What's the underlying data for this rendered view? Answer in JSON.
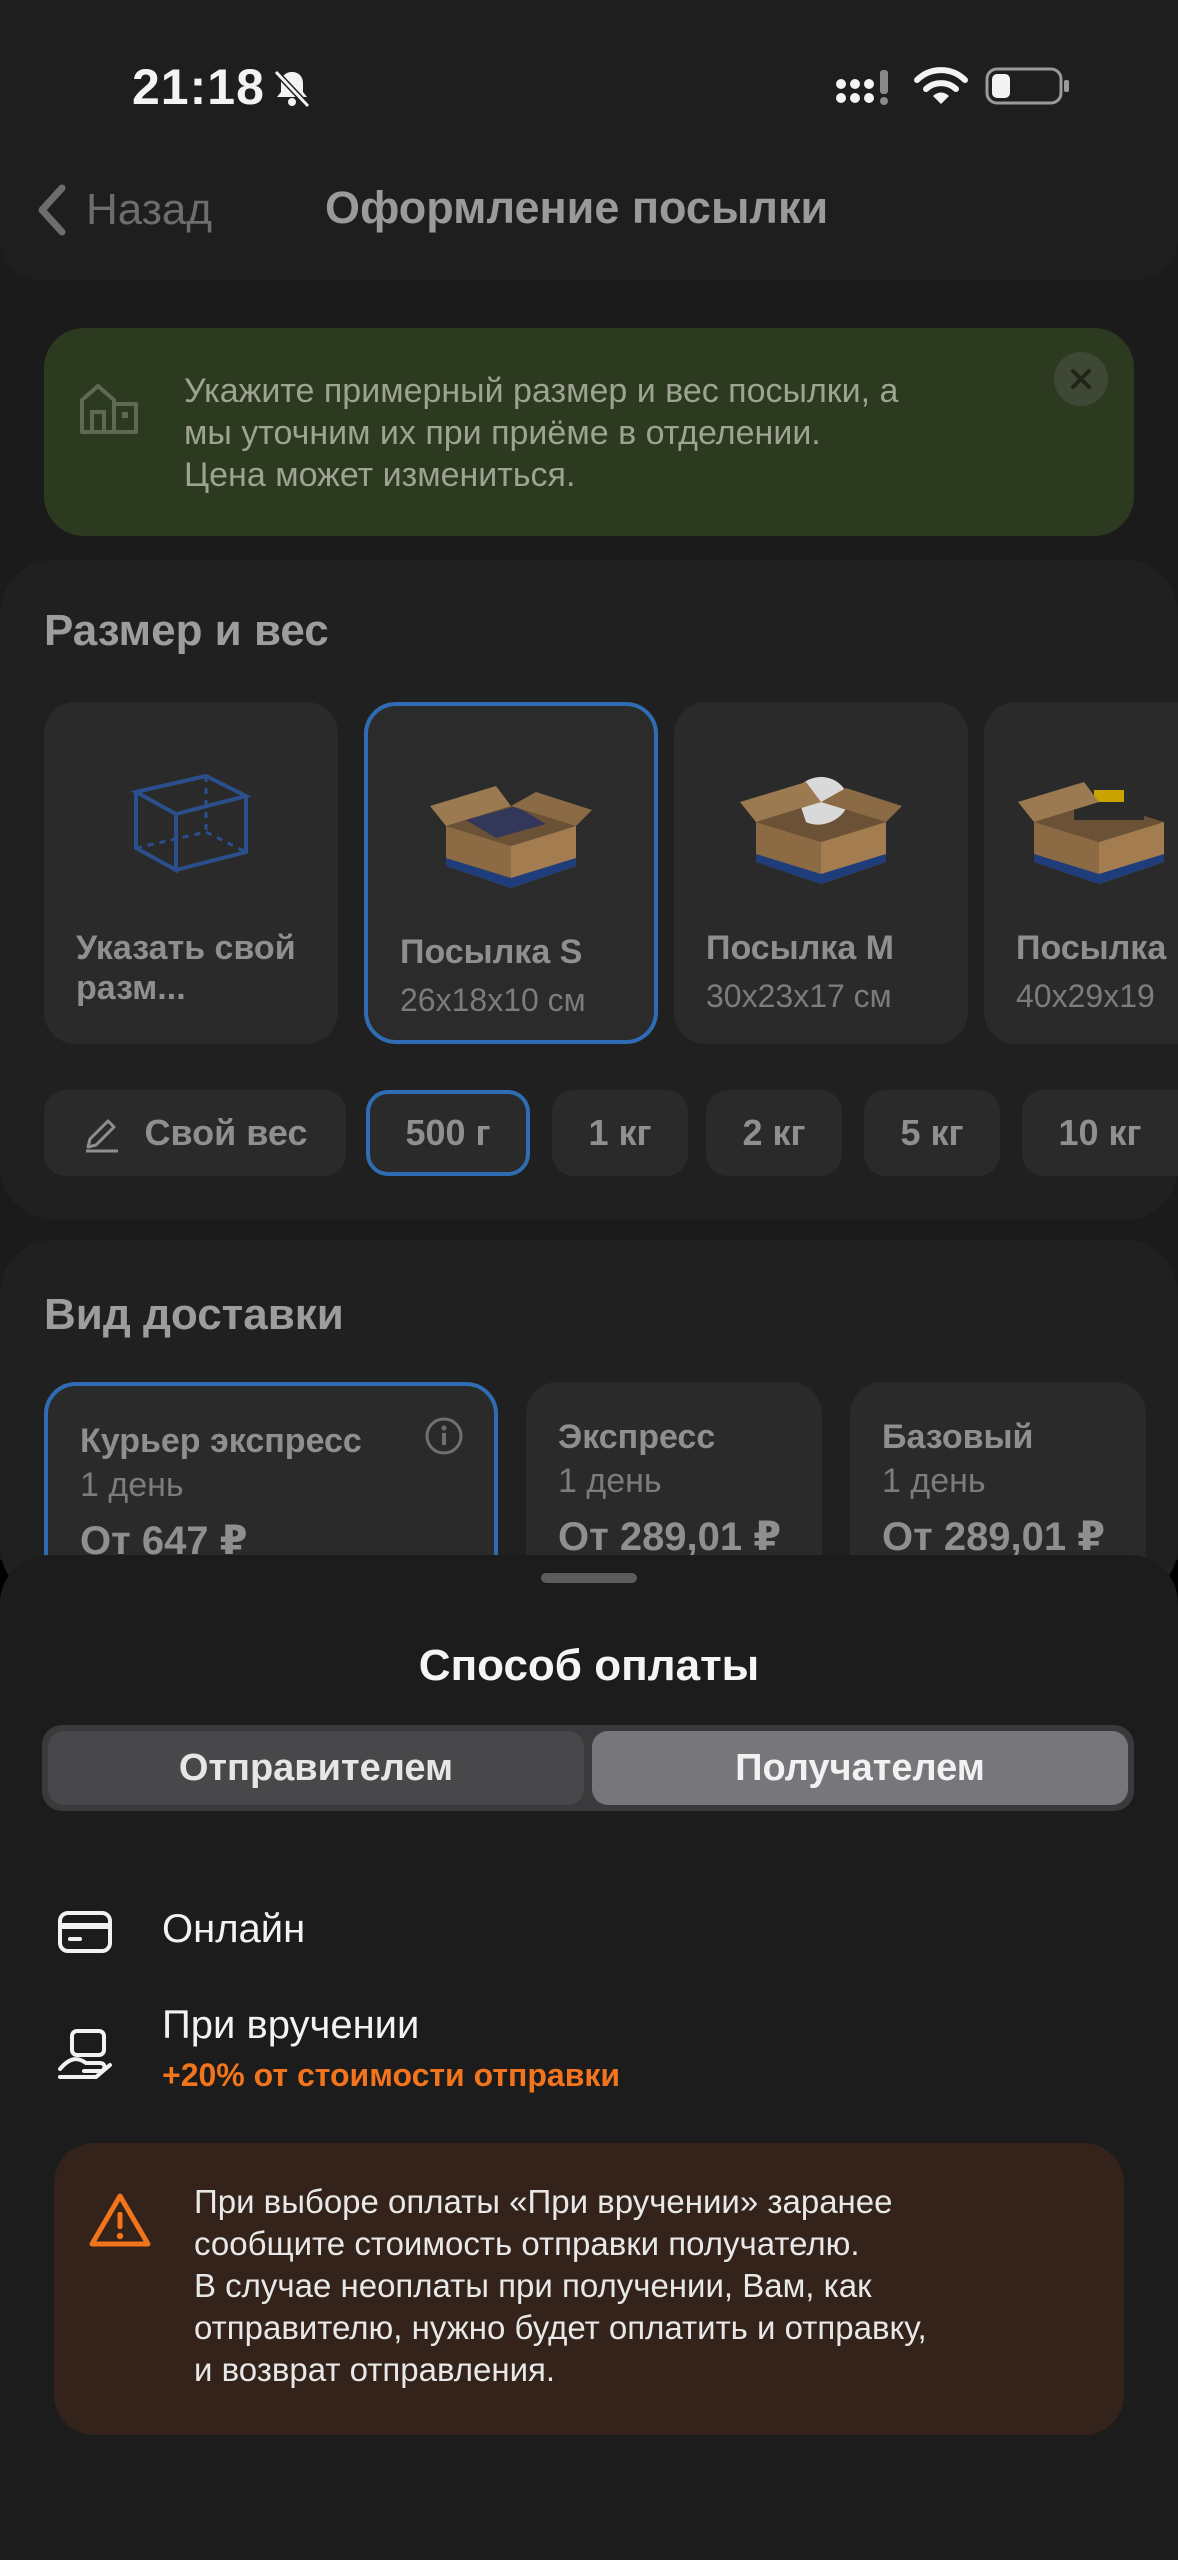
{
  "status_bar": {
    "time": "21:18"
  },
  "nav": {
    "back_label": "Назад",
    "title": "Оформление посылки"
  },
  "notice": {
    "lines": [
      "Укажите примерный размер и вес посылки, а",
      "мы уточним их при приёме в отделении.",
      "Цена может измениться."
    ]
  },
  "size_section": {
    "title": "Размер и вес",
    "tiles": [
      {
        "name": "Указать свой разм...",
        "dims": ""
      },
      {
        "name": "Посылка S",
        "dims": "26x18x10 см"
      },
      {
        "name": "Посылка M",
        "dims": "30x23x17 см"
      },
      {
        "name": "Посылка",
        "dims": "40x29x19"
      }
    ],
    "selected_tile": 1,
    "weights": [
      "Свой вес",
      "500 г",
      "1 кг",
      "2 кг",
      "5 кг",
      "10 кг"
    ],
    "selected_weight": 1
  },
  "delivery_section": {
    "title": "Вид доставки",
    "options": [
      {
        "name": "Курьер экспресс",
        "days": "1 день",
        "price": "От 647 ₽"
      },
      {
        "name": "Экспресс",
        "days": "1 день",
        "price": "От 289,01 ₽"
      },
      {
        "name": "Базовый",
        "days": "1 день",
        "price": "От 289,01 ₽"
      }
    ]
  },
  "payment_sheet": {
    "title": "Способ оплаты",
    "segments": [
      "Отправителем",
      "Получателем"
    ],
    "selected_segment": 1,
    "options": [
      {
        "label": "Онлайн",
        "icon": "card-icon"
      },
      {
        "label": "При вручении",
        "sub": "+20% от стоимости отправки",
        "icon": "hand-cash-icon"
      }
    ],
    "warning": {
      "lines": [
        "При выборе оплаты «При вручении» заранее",
        "сообщите стоимость отправки получателю.",
        "В случае неоплаты при получении, Вам, как",
        "отправителю, нужно будет оплатить и отправку,",
        "и возврат отправления."
      ]
    }
  },
  "colors": {
    "accent_blue": "#2f6cb4",
    "warning_orange": "#f2741d",
    "notice_green": "#2c3a1f"
  }
}
